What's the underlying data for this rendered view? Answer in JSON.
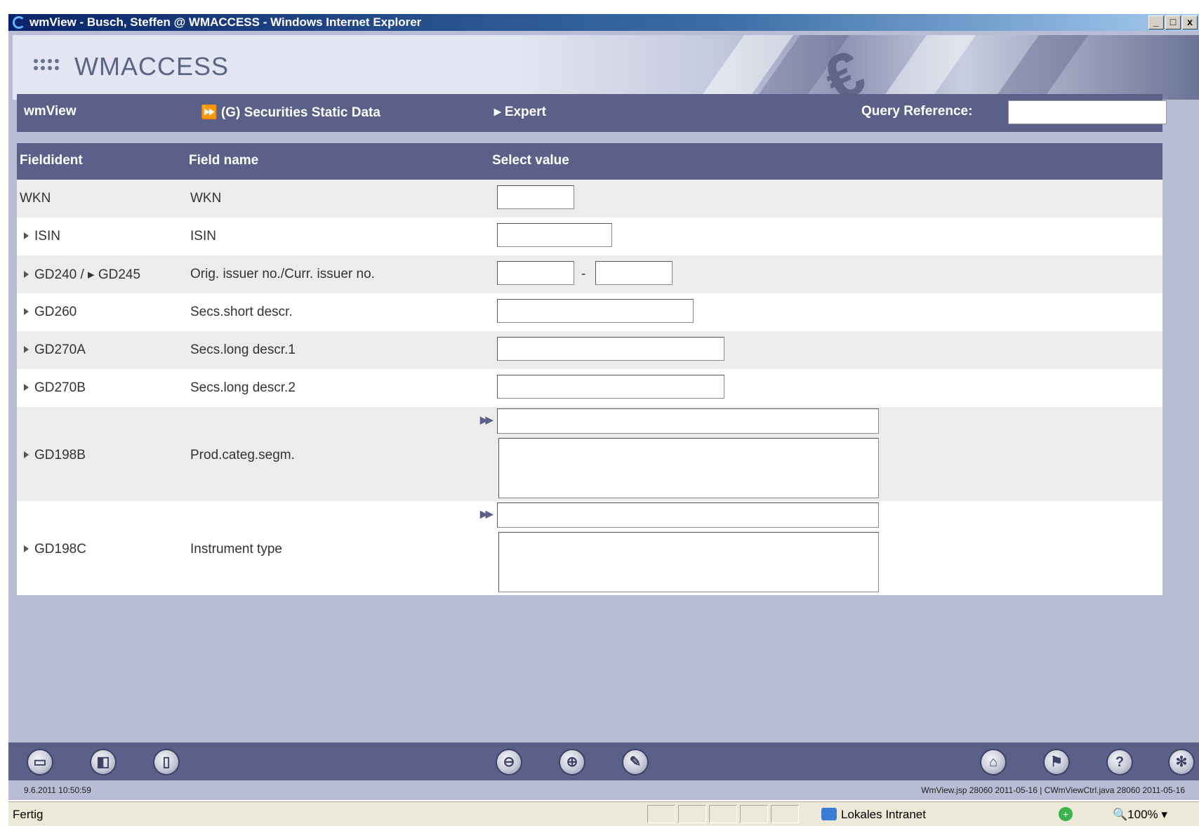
{
  "window": {
    "title": "wmView - Busch, Steffen @ WMACCESS - Windows Internet Explorer",
    "buttons": [
      "_",
      "□",
      "x"
    ]
  },
  "banner": {
    "logo_text": "WMACCESS",
    "euro_symbol": "€"
  },
  "nav": {
    "app_name": "wmView",
    "section": "⏩ (G) Securities Static Data",
    "mode": "▸ Expert",
    "query_label": "Query Reference:",
    "query_value": ""
  },
  "table": {
    "headers": [
      "Fieldident",
      "Field name",
      "Select value"
    ],
    "rows": [
      {
        "ident": "WKN",
        "name": "WKN"
      },
      {
        "ident": "ISIN",
        "name": "ISIN"
      },
      {
        "ident": "GD240 / ▸ GD245",
        "name": "Orig. issuer no./Curr. issuer no.",
        "separator": "-"
      },
      {
        "ident": "GD260",
        "name": "Secs.short descr."
      },
      {
        "ident": "GD270A",
        "name": "Secs.long descr.1"
      },
      {
        "ident": "GD270B",
        "name": "Secs.long descr.2"
      },
      {
        "ident": "GD198B",
        "name": "Prod.categ.segm."
      },
      {
        "ident": "GD198C",
        "name": "Instrument type"
      }
    ]
  },
  "toolbar": {
    "left_icons": [
      "print-icon",
      "preview-icon",
      "book-icon"
    ],
    "center_icons": [
      "zoom-out-icon",
      "zoom-in-icon",
      "erase-icon"
    ],
    "right_icons": [
      "home-icon",
      "flag-icon",
      "help-icon",
      "settings-icon"
    ]
  },
  "info": {
    "timestamp": "9.6.2011 10:50:59",
    "version": "WmView.jsp 28060 2011-05-16 | CWmViewCtrl.java 28060 2011-05-16"
  },
  "statusbar": {
    "status": "Fertig",
    "zone": "Lokales Intranet",
    "zoom": "100%"
  }
}
